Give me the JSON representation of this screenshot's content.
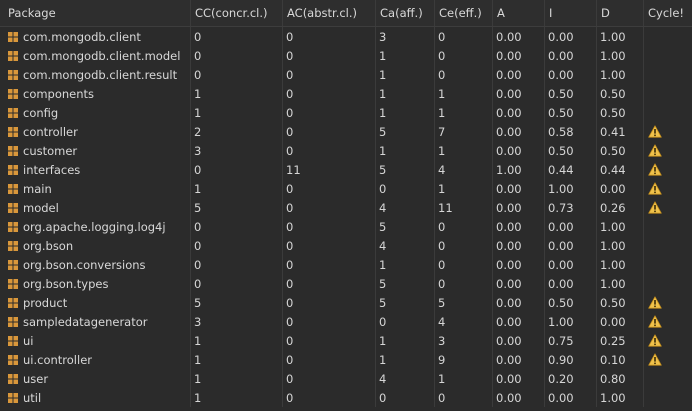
{
  "columns": [
    "Package",
    "CC(concr.cl.)",
    "AC(abstr.cl.)",
    "Ca(aff.)",
    "Ce(eff.)",
    "A",
    "I",
    "D",
    "Cycle!"
  ],
  "icons": {
    "package": "package-icon",
    "cycle": "warning-icon"
  },
  "colors": {
    "background": "#2b2b2b",
    "text": "#d6d6d6",
    "package_icon": "#d9973b",
    "warning_fill": "#f0c24b"
  },
  "rows": [
    {
      "package": "com.mongodb.client",
      "cc": "0",
      "ac": "0",
      "ca": "3",
      "ce": "0",
      "a": "0.00",
      "i": "0.00",
      "d": "1.00",
      "cycle": false
    },
    {
      "package": "com.mongodb.client.model",
      "cc": "0",
      "ac": "0",
      "ca": "1",
      "ce": "0",
      "a": "0.00",
      "i": "0.00",
      "d": "1.00",
      "cycle": false
    },
    {
      "package": "com.mongodb.client.result",
      "cc": "0",
      "ac": "0",
      "ca": "1",
      "ce": "0",
      "a": "0.00",
      "i": "0.00",
      "d": "1.00",
      "cycle": false
    },
    {
      "package": "components",
      "cc": "1",
      "ac": "0",
      "ca": "1",
      "ce": "1",
      "a": "0.00",
      "i": "0.50",
      "d": "0.50",
      "cycle": false
    },
    {
      "package": "config",
      "cc": "1",
      "ac": "0",
      "ca": "1",
      "ce": "1",
      "a": "0.00",
      "i": "0.50",
      "d": "0.50",
      "cycle": false
    },
    {
      "package": "controller",
      "cc": "2",
      "ac": "0",
      "ca": "5",
      "ce": "7",
      "a": "0.00",
      "i": "0.58",
      "d": "0.41",
      "cycle": true
    },
    {
      "package": "customer",
      "cc": "3",
      "ac": "0",
      "ca": "1",
      "ce": "1",
      "a": "0.00",
      "i": "0.50",
      "d": "0.50",
      "cycle": true
    },
    {
      "package": "interfaces",
      "cc": "0",
      "ac": "11",
      "ca": "5",
      "ce": "4",
      "a": "1.00",
      "i": "0.44",
      "d": "0.44",
      "cycle": true
    },
    {
      "package": "main",
      "cc": "1",
      "ac": "0",
      "ca": "0",
      "ce": "1",
      "a": "0.00",
      "i": "1.00",
      "d": "0.00",
      "cycle": true
    },
    {
      "package": "model",
      "cc": "5",
      "ac": "0",
      "ca": "4",
      "ce": "11",
      "a": "0.00",
      "i": "0.73",
      "d": "0.26",
      "cycle": true
    },
    {
      "package": "org.apache.logging.log4j",
      "cc": "0",
      "ac": "0",
      "ca": "5",
      "ce": "0",
      "a": "0.00",
      "i": "0.00",
      "d": "1.00",
      "cycle": false
    },
    {
      "package": "org.bson",
      "cc": "0",
      "ac": "0",
      "ca": "4",
      "ce": "0",
      "a": "0.00",
      "i": "0.00",
      "d": "1.00",
      "cycle": false
    },
    {
      "package": "org.bson.conversions",
      "cc": "0",
      "ac": "0",
      "ca": "1",
      "ce": "0",
      "a": "0.00",
      "i": "0.00",
      "d": "1.00",
      "cycle": false
    },
    {
      "package": "org.bson.types",
      "cc": "0",
      "ac": "0",
      "ca": "5",
      "ce": "0",
      "a": "0.00",
      "i": "0.00",
      "d": "1.00",
      "cycle": false
    },
    {
      "package": "product",
      "cc": "5",
      "ac": "0",
      "ca": "5",
      "ce": "5",
      "a": "0.00",
      "i": "0.50",
      "d": "0.50",
      "cycle": true
    },
    {
      "package": "sampledatagenerator",
      "cc": "3",
      "ac": "0",
      "ca": "0",
      "ce": "4",
      "a": "0.00",
      "i": "1.00",
      "d": "0.00",
      "cycle": true
    },
    {
      "package": "ui",
      "cc": "1",
      "ac": "0",
      "ca": "1",
      "ce": "3",
      "a": "0.00",
      "i": "0.75",
      "d": "0.25",
      "cycle": true
    },
    {
      "package": "ui.controller",
      "cc": "1",
      "ac": "0",
      "ca": "1",
      "ce": "9",
      "a": "0.00",
      "i": "0.90",
      "d": "0.10",
      "cycle": true
    },
    {
      "package": "user",
      "cc": "1",
      "ac": "0",
      "ca": "4",
      "ce": "1",
      "a": "0.00",
      "i": "0.20",
      "d": "0.80",
      "cycle": false
    },
    {
      "package": "util",
      "cc": "1",
      "ac": "0",
      "ca": "0",
      "ce": "0",
      "a": "0.00",
      "i": "0.00",
      "d": "1.00",
      "cycle": false
    }
  ]
}
